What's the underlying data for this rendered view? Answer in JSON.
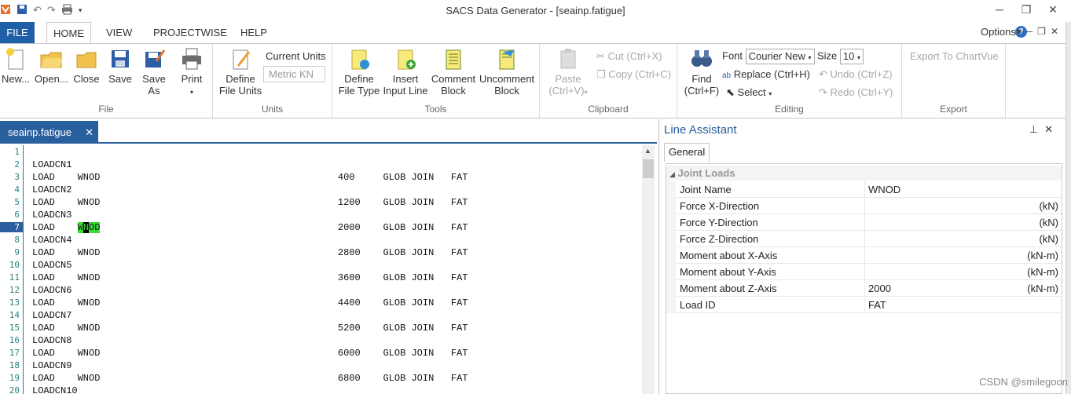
{
  "window": {
    "title": "SACS Data Generator - [seainp.fatigue]"
  },
  "menu": {
    "file": "FILE",
    "tabs": [
      "HOME",
      "VIEW",
      "PROJECTWISE",
      "HELP"
    ],
    "options": "Options"
  },
  "ribbon": {
    "file": {
      "new": "New...",
      "open": "Open...",
      "close": "Close",
      "save": "Save",
      "save_as_1": "Save",
      "save_as_2": "As",
      "print": "Print",
      "label": "File"
    },
    "units": {
      "define_1": "Define",
      "define_2": "File Units",
      "current_label": "Current Units",
      "current_value": "Metric KN",
      "label": "Units"
    },
    "tools": {
      "define_type_1": "Define",
      "define_type_2": "File Type",
      "insert_1": "Insert",
      "insert_2": "Input Line",
      "comment_1": "Comment",
      "comment_2": "Block",
      "uncomment_1": "Uncomment",
      "uncomment_2": "Block",
      "label": "Tools"
    },
    "clipboard": {
      "paste_1": "Paste",
      "paste_2": "(Ctrl+V)",
      "cut": "Cut (Ctrl+X)",
      "copy": "Copy (Ctrl+C)",
      "label": "Clipboard"
    },
    "editing": {
      "find_1": "Find",
      "find_2": "(Ctrl+F)",
      "font_label": "Font",
      "font_value": "Courier New",
      "size_label": "Size",
      "size_value": "10",
      "replace": "Replace (Ctrl+H)",
      "select": "Select",
      "undo": "Undo (Ctrl+Z)",
      "redo": "Redo (Ctrl+Y)",
      "label": "Editing"
    },
    "export": {
      "chartvue": "Export To ChartVue",
      "label": "Export"
    }
  },
  "editor": {
    "tab": "seainp.fatigue",
    "current_line": 7,
    "lines": [
      {
        "n": "1",
        "text": ""
      },
      {
        "n": "2",
        "text": "LOADCN1"
      },
      {
        "n": "3",
        "text": "LOAD    WNOD                                          400     GLOB JOIN   FAT"
      },
      {
        "n": "4",
        "text": "LOADCN2"
      },
      {
        "n": "5",
        "text": "LOAD    WNOD                                          1200    GLOB JOIN   FAT"
      },
      {
        "n": "6",
        "text": "LOADCN3"
      },
      {
        "n": "7",
        "text": "LOAD    "
      },
      {
        "n": "8",
        "text": "LOADCN4"
      },
      {
        "n": "9",
        "text": "LOAD    WNOD                                          2800    GLOB JOIN   FAT"
      },
      {
        "n": "10",
        "text": "LOADCN5"
      },
      {
        "n": "11",
        "text": "LOAD    WNOD                                          3600    GLOB JOIN   FAT"
      },
      {
        "n": "12",
        "text": "LOADCN6"
      },
      {
        "n": "13",
        "text": "LOAD    WNOD                                          4400    GLOB JOIN   FAT"
      },
      {
        "n": "14",
        "text": "LOADCN7"
      },
      {
        "n": "15",
        "text": "LOAD    WNOD                                          5200    GLOB JOIN   FAT"
      },
      {
        "n": "16",
        "text": "LOADCN8"
      },
      {
        "n": "17",
        "text": "LOAD    WNOD                                          6000    GLOB JOIN   FAT"
      },
      {
        "n": "18",
        "text": "LOADCN9"
      },
      {
        "n": "19",
        "text": "LOAD    WNOD                                          6800    GLOB JOIN   FAT"
      },
      {
        "n": "20",
        "text": "LOADCN10"
      }
    ],
    "line7": {
      "sel_a": "W",
      "sel_b": "N",
      "sel_c": "OD",
      "rest": "                                          2000    GLOB JOIN   FAT"
    }
  },
  "assistant": {
    "title": "Line Assistant",
    "tab": "General",
    "category": "Joint Loads",
    "rows": [
      {
        "name": "Joint Name",
        "value": "WNOD",
        "unit": ""
      },
      {
        "name": "Force X-Direction",
        "value": "",
        "unit": "(kN)"
      },
      {
        "name": "Force Y-Direction",
        "value": "",
        "unit": "(kN)"
      },
      {
        "name": "Force Z-Direction",
        "value": "",
        "unit": "(kN)"
      },
      {
        "name": "Moment about X-Axis",
        "value": "",
        "unit": "(kN-m)"
      },
      {
        "name": "Moment about Y-Axis",
        "value": "",
        "unit": "(kN-m)"
      },
      {
        "name": "Moment about Z-Axis",
        "value": "2000",
        "unit": "(kN-m)"
      },
      {
        "name": "Load ID",
        "value": "FAT",
        "unit": ""
      }
    ]
  },
  "watermark": "CSDN @smilegoon"
}
